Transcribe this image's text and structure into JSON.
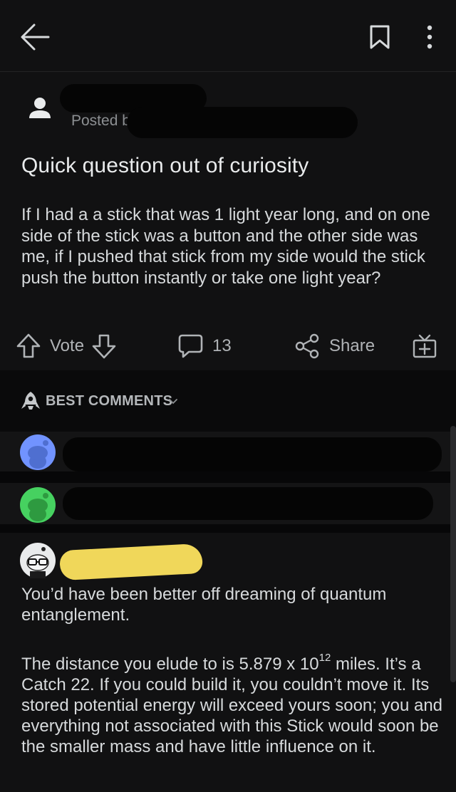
{
  "icons": {
    "back": "back-arrow-icon",
    "save": "bookmark-icon",
    "more": "more-vertical-icon",
    "user": "user-icon",
    "upvote": "upvote-arrow-icon",
    "downvote": "downvote-arrow-icon",
    "comments": "comment-bubble-icon",
    "share": "share-icon",
    "award": "gift-icon",
    "sort": "rocket-icon",
    "chevron": "chevron-down-icon"
  },
  "post": {
    "posted_by": "Posted b",
    "title": "Quick question out of curiosity",
    "body": "If I had a a stick that was 1 light year long, and on one side of the stick was a button and the other side was me, if I pushed that stick from my side would the stick push the button instantly or take one light year?"
  },
  "actions": {
    "vote_label": "Vote",
    "comment_count": "13",
    "share_label": "Share"
  },
  "comments_header": {
    "sort_label": "BEST COMMENTS"
  },
  "comment": {
    "paragraph1": "You’d have been better off dreaming of quantum entanglement.",
    "paragraph2_pre": "The distance you elude to is 5.879 x 10",
    "paragraph2_sup": "12",
    "paragraph2_post": " miles.  It’s a Catch 22.  If you could build it, you couldn’t move it. Its stored potential energy will exceed yours soon; you and everything not associated with this Stick would soon be the smaller mass and have little influence on it."
  },
  "colors": {
    "background": "#111112",
    "text": "#d7dadc",
    "muted": "#8c8f92",
    "highlight_redaction": "#f0d75a",
    "snoo_blue": "#7193ff",
    "snoo_green": "#46d160"
  }
}
